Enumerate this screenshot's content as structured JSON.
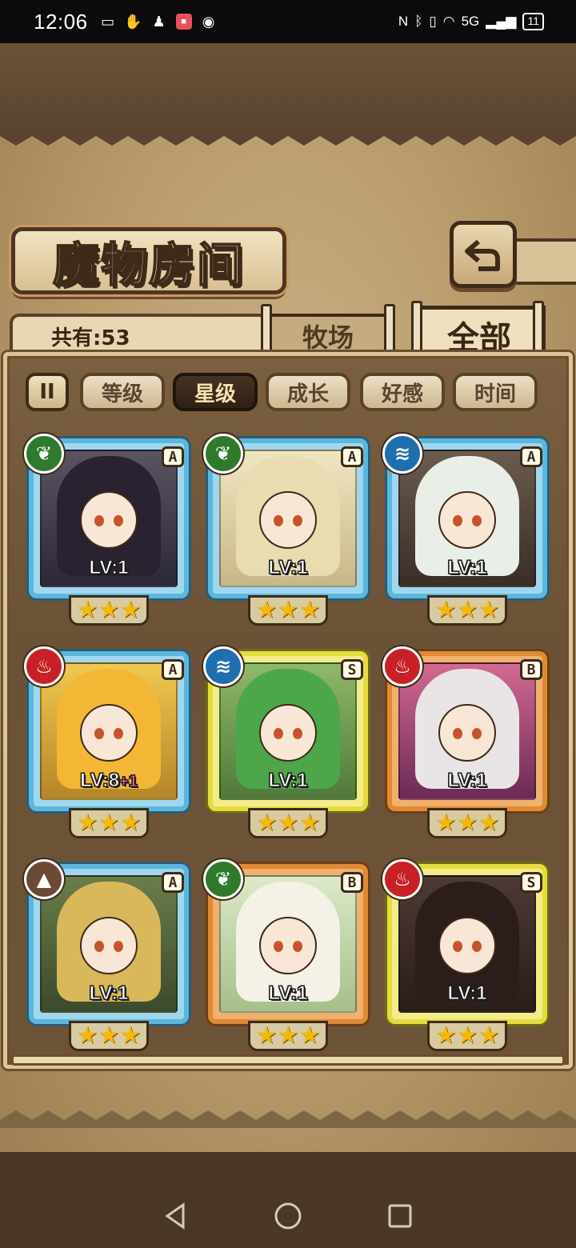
{
  "status_bar": {
    "time": "12:06",
    "battery": "11",
    "network": "5G"
  },
  "screen": {
    "title": "魔物房间",
    "back_icon": "back-arrow-icon"
  },
  "summary": {
    "count_label": "共有:53"
  },
  "tabs": [
    {
      "label": "牧场",
      "active": false
    },
    {
      "label": "全部",
      "active": true
    }
  ],
  "sort": {
    "toggle_label": "II",
    "options": [
      {
        "label": "等级",
        "active": false
      },
      {
        "label": "星级",
        "active": true
      },
      {
        "label": "成长",
        "active": false
      },
      {
        "label": "好感",
        "active": false
      },
      {
        "label": "时间",
        "active": false
      }
    ]
  },
  "monsters": [
    {
      "element": "nature",
      "rank": "A",
      "level": "LV:1",
      "plus": "",
      "stars": "★★★",
      "frame": "blue"
    },
    {
      "element": "nature",
      "rank": "A",
      "level": "LV:1",
      "plus": "",
      "stars": "★★★",
      "frame": "blue"
    },
    {
      "element": "water",
      "rank": "A",
      "level": "LV:1",
      "plus": "",
      "stars": "★★★",
      "frame": "blue"
    },
    {
      "element": "fire",
      "rank": "A",
      "level": "LV:8",
      "plus": "+1",
      "stars": "★★★",
      "frame": "blue"
    },
    {
      "element": "water",
      "rank": "S",
      "level": "LV:1",
      "plus": "",
      "stars": "★★★",
      "frame": "yellow"
    },
    {
      "element": "fire",
      "rank": "B",
      "level": "LV:1",
      "plus": "",
      "stars": "★★★",
      "frame": "orange"
    },
    {
      "element": "earth",
      "rank": "A",
      "level": "LV:1",
      "plus": "",
      "stars": "★★★",
      "frame": "blue"
    },
    {
      "element": "nature",
      "rank": "B",
      "level": "LV:1",
      "plus": "",
      "stars": "★★★",
      "frame": "orange"
    },
    {
      "element": "fire",
      "rank": "S",
      "level": "LV:1",
      "plus": "",
      "stars": "★★★",
      "frame": "yellow"
    }
  ],
  "colors": {
    "parchment": "#b89b6b",
    "frame_blue": "#5cb7dc",
    "frame_yellow": "#e6dc3c",
    "frame_orange": "#e08a36",
    "star": "#f2b90c"
  }
}
